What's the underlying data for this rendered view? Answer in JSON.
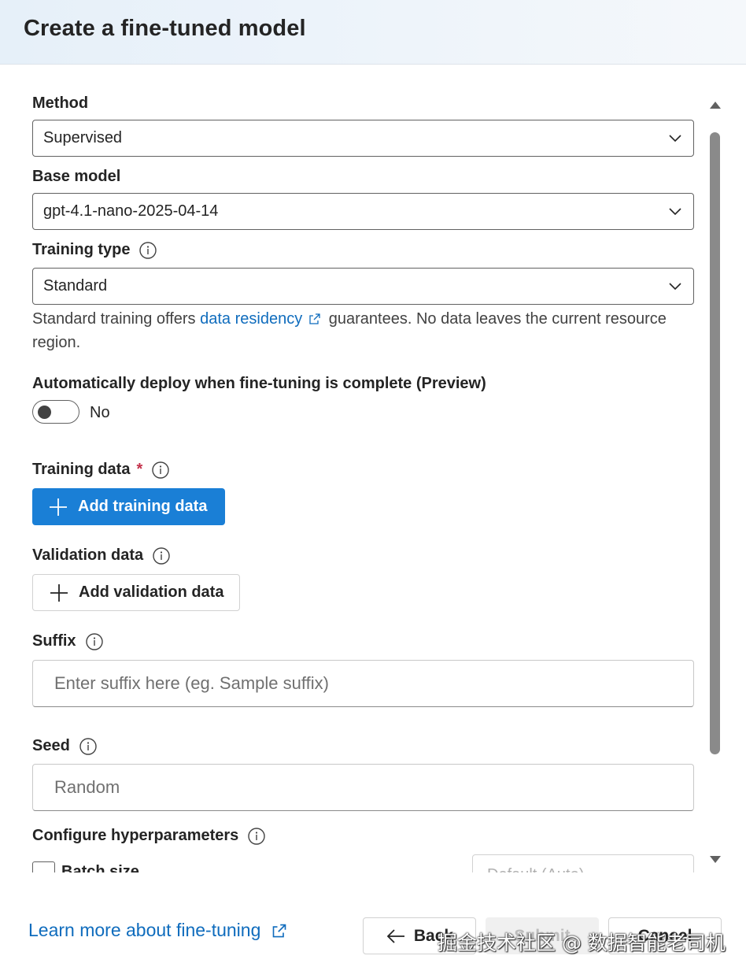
{
  "dialog": {
    "title": "Create a fine-tuned model"
  },
  "method": {
    "label": "Method",
    "value": "Supervised"
  },
  "base_model": {
    "label": "Base model",
    "value": "gpt-4.1-nano-2025-04-14"
  },
  "training_type": {
    "label": "Training type",
    "value": "Standard",
    "helper_before": "Standard training offers",
    "helper_link": "data residency",
    "helper_after": "guarantees. No data leaves the current resource region."
  },
  "auto_deploy": {
    "label": "Automatically deploy when fine-tuning is complete (Preview)",
    "state_label": "No",
    "enabled": false
  },
  "training_data": {
    "label": "Training data",
    "required_mark": "*",
    "button_label": "Add training data"
  },
  "validation_data": {
    "label": "Validation data",
    "button_label": "Add validation data"
  },
  "suffix": {
    "label": "Suffix",
    "placeholder": "Enter suffix here (eg. Sample suffix)"
  },
  "seed": {
    "label": "Seed",
    "placeholder": "Random"
  },
  "hyperparameters": {
    "label": "Configure hyperparameters",
    "batch_size_label": "Batch size",
    "batch_size_placeholder": "Default (Auto)"
  },
  "footer": {
    "learn_more": "Learn more about fine-tuning",
    "back": "Back",
    "submit": "Submit",
    "cancel": "Cancel"
  },
  "watermark": "掘金技术社区 @ 数据智能老司机",
  "colors": {
    "primary": "#1a7fd6",
    "link": "#0f6cbd",
    "required": "#c4314b"
  },
  "icons": [
    "info-icon",
    "chevron-down-icon",
    "external-link-icon",
    "plus-icon",
    "arrow-left-icon"
  ]
}
